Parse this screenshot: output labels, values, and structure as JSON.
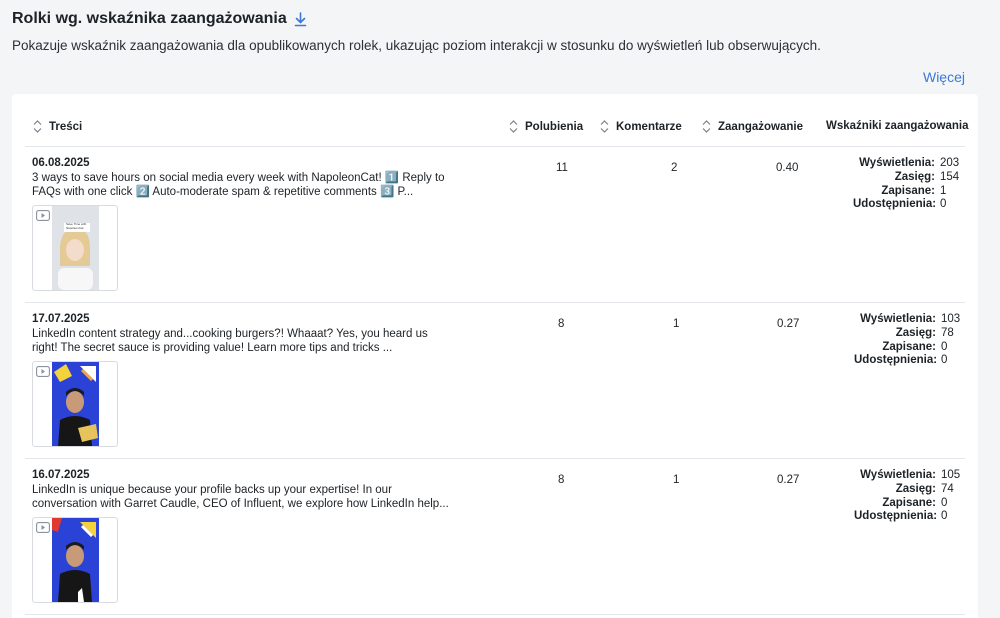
{
  "header": {
    "title": "Rolki wg. wskaźnika zaangażowania",
    "subtitle": "Pokazuje wskaźnik zaangażowania dla opublikowanych rolek, ukazując poziom interakcji w stosunku do wyświetleń lub obserwujących.",
    "more_link": "Więcej",
    "download_icon": "download-icon"
  },
  "table": {
    "columns": {
      "content": "Treści",
      "likes": "Polubienia",
      "comments": "Komentarze",
      "engagement": "Zaangażowanie",
      "metrics": "Wskaźniki zaangażowania"
    },
    "metric_labels": {
      "views": "Wyświetlenia:",
      "reach": "Zasięg:",
      "saved": "Zapisane:",
      "shares": "Udostępnienia:"
    },
    "rows": [
      {
        "date": "06.08.2025",
        "text": "3 ways to save hours on social media every week with NapoleonCat! 1️⃣ Reply to FAQs with one click 2️⃣ Auto-moderate spam & repetitive comments 3️⃣ P...",
        "thumb_caption": "Save Time with NapoleonCat",
        "likes": "11",
        "comments": "2",
        "engagement": "0.40",
        "views": "203",
        "reach": "154",
        "saved": "1",
        "shares": "0"
      },
      {
        "date": "17.07.2025",
        "text": "LinkedIn content strategy and...cooking burgers?! Whaaat? Yes, you heard us right! The secret sauce is providing value! Learn more tips and tricks ...",
        "likes": "8",
        "comments": "1",
        "engagement": "0.27",
        "views": "103",
        "reach": "78",
        "saved": "0",
        "shares": "0"
      },
      {
        "date": "16.07.2025",
        "text": "LinkedIn is unique because your profile backs up your expertise! In our conversation with Garret Caudle, CEO of Influent, we explore how LinkedIn help...",
        "likes": "8",
        "comments": "1",
        "engagement": "0.27",
        "views": "105",
        "reach": "74",
        "saved": "0",
        "shares": "0"
      }
    ]
  },
  "colors": {
    "accent": "#3b78d8",
    "border": "#e3e6ea",
    "background": "#f4f5f7"
  }
}
